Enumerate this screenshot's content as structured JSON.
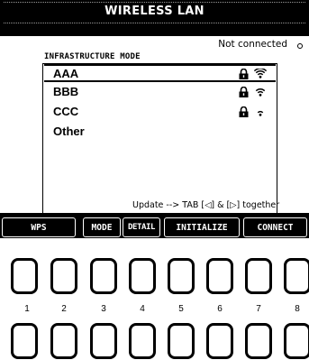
{
  "window": {
    "title": "WIRELESS LAN"
  },
  "status": {
    "connection": "Not connected"
  },
  "list": {
    "mode_label": "INFRASTRUCTURE MODE",
    "networks": [
      {
        "name": "AAA",
        "secured": true,
        "signal": 3,
        "selected": true
      },
      {
        "name": "BBB",
        "secured": true,
        "signal": 2,
        "selected": false
      },
      {
        "name": "CCC",
        "secured": true,
        "signal": 1,
        "selected": false
      },
      {
        "name": "Other",
        "secured": false,
        "signal": 0,
        "selected": false
      }
    ],
    "hint": "Update --> TAB [◁] & [▷] together"
  },
  "function_buttons": [
    {
      "label": "WPS"
    },
    {
      "label": "MODE"
    },
    {
      "label": "DETAIL"
    },
    {
      "label": "INITIALIZE"
    },
    {
      "label": "CONNECT"
    }
  ],
  "hardware_buttons": {
    "numbers": [
      "1",
      "2",
      "3",
      "4",
      "5",
      "6",
      "7",
      "8"
    ]
  },
  "icons": {
    "lock": "lock-icon",
    "wifi": "wifi-signal-icon",
    "status": "status-dot-icon"
  },
  "colors": {
    "screen_bg": "#000000",
    "content_bg": "#ffffff",
    "text": "#000000"
  }
}
